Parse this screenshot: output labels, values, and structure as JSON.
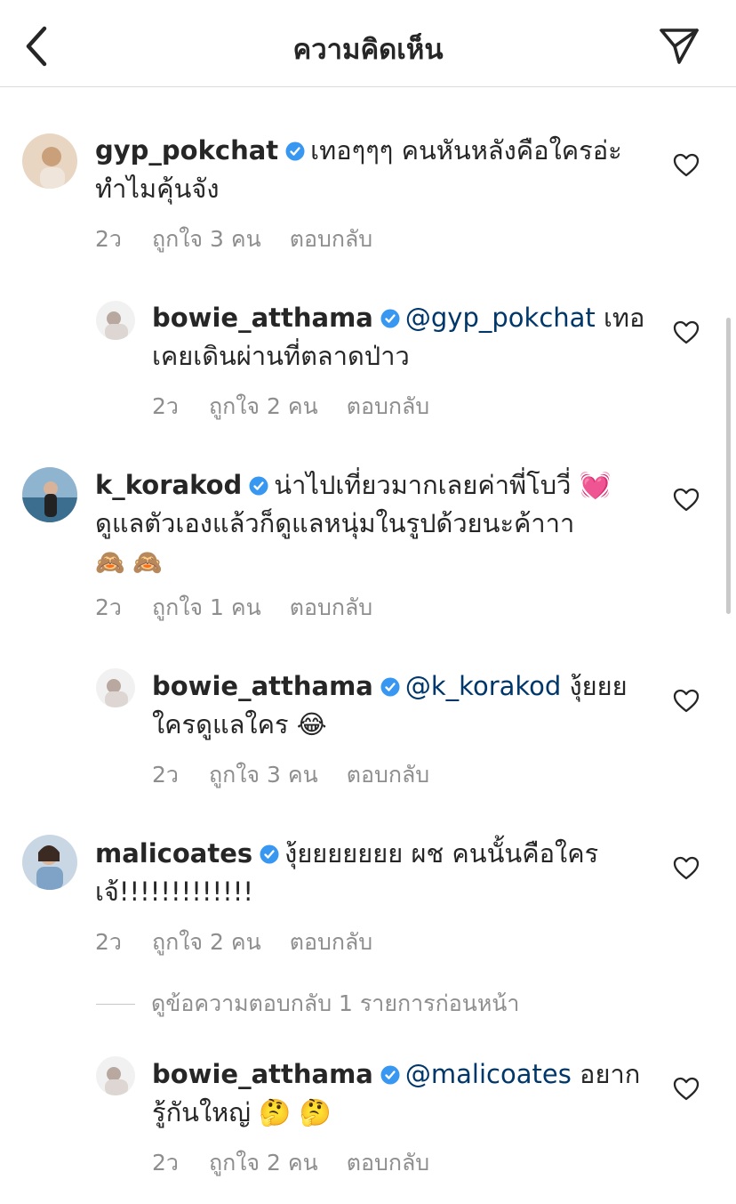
{
  "header": {
    "title": "ความคิดเห็น"
  },
  "comments": [
    {
      "username": "gyp_pokchat",
      "mention": "",
      "text": "เทอๆๆๆ คนหันหลังคือใครอ่ะ",
      "text2": "ทำไมคุ้นจัง",
      "time": "2ว",
      "likes": "ถูกใจ 3 คน",
      "reply": "ตอบกลับ"
    },
    {
      "username": "bowie_atthama",
      "mention": "@gyp_pokchat",
      "text": " เทอ",
      "text2": "เคยเดินผ่านที่ตลาดป่าว",
      "time": "2ว",
      "likes": "ถูกใจ 2 คน",
      "reply": "ตอบกลับ"
    },
    {
      "username": "k_korakod",
      "mention": "",
      "text": "น่าไปเที่ยวมากเลยค่าพี่โบวี่ 💓",
      "text2": "ดูแลตัวเองแล้วก็ดูแลหนุ่มในรูปด้วยนะค้าาา",
      "text3": "🙈 🙈",
      "time": "2ว",
      "likes": "ถูกใจ 1 คน",
      "reply": "ตอบกลับ"
    },
    {
      "username": "bowie_atthama",
      "mention": "@k_korakod",
      "text": " งุ้ยยย",
      "text2": "ใครดูแลใคร 😂",
      "time": "2ว",
      "likes": "ถูกใจ 3 คน",
      "reply": "ตอบกลับ"
    },
    {
      "username": "malicoates",
      "mention": "",
      "text": "งุ้ยยยยยยย ผช คนนั้นคือใคร",
      "text2": "เจ้!!!!!!!!!!!!!",
      "time": "2ว",
      "likes": "ถูกใจ 2 คน",
      "reply": "ตอบกลับ"
    },
    {
      "username": "bowie_atthama",
      "mention": "@malicoates",
      "text": " อยาก",
      "text2": "รู้กันใหญ่ 🤔 🤔",
      "time": "2ว",
      "likes": "ถูกใจ 2 คน",
      "reply": "ตอบกลับ"
    }
  ],
  "view_previous_replies": "ดูข้อความตอบกลับ 1 รายการก่อนหน้า",
  "colors": {
    "verified": "#3897f0",
    "mention": "#00376b",
    "meta": "#8e8e8e",
    "text": "#262626"
  },
  "icons": {
    "back": "chevron-left-icon",
    "send": "paper-plane-icon",
    "like": "heart-outline-icon",
    "verified": "verified-badge-icon"
  }
}
